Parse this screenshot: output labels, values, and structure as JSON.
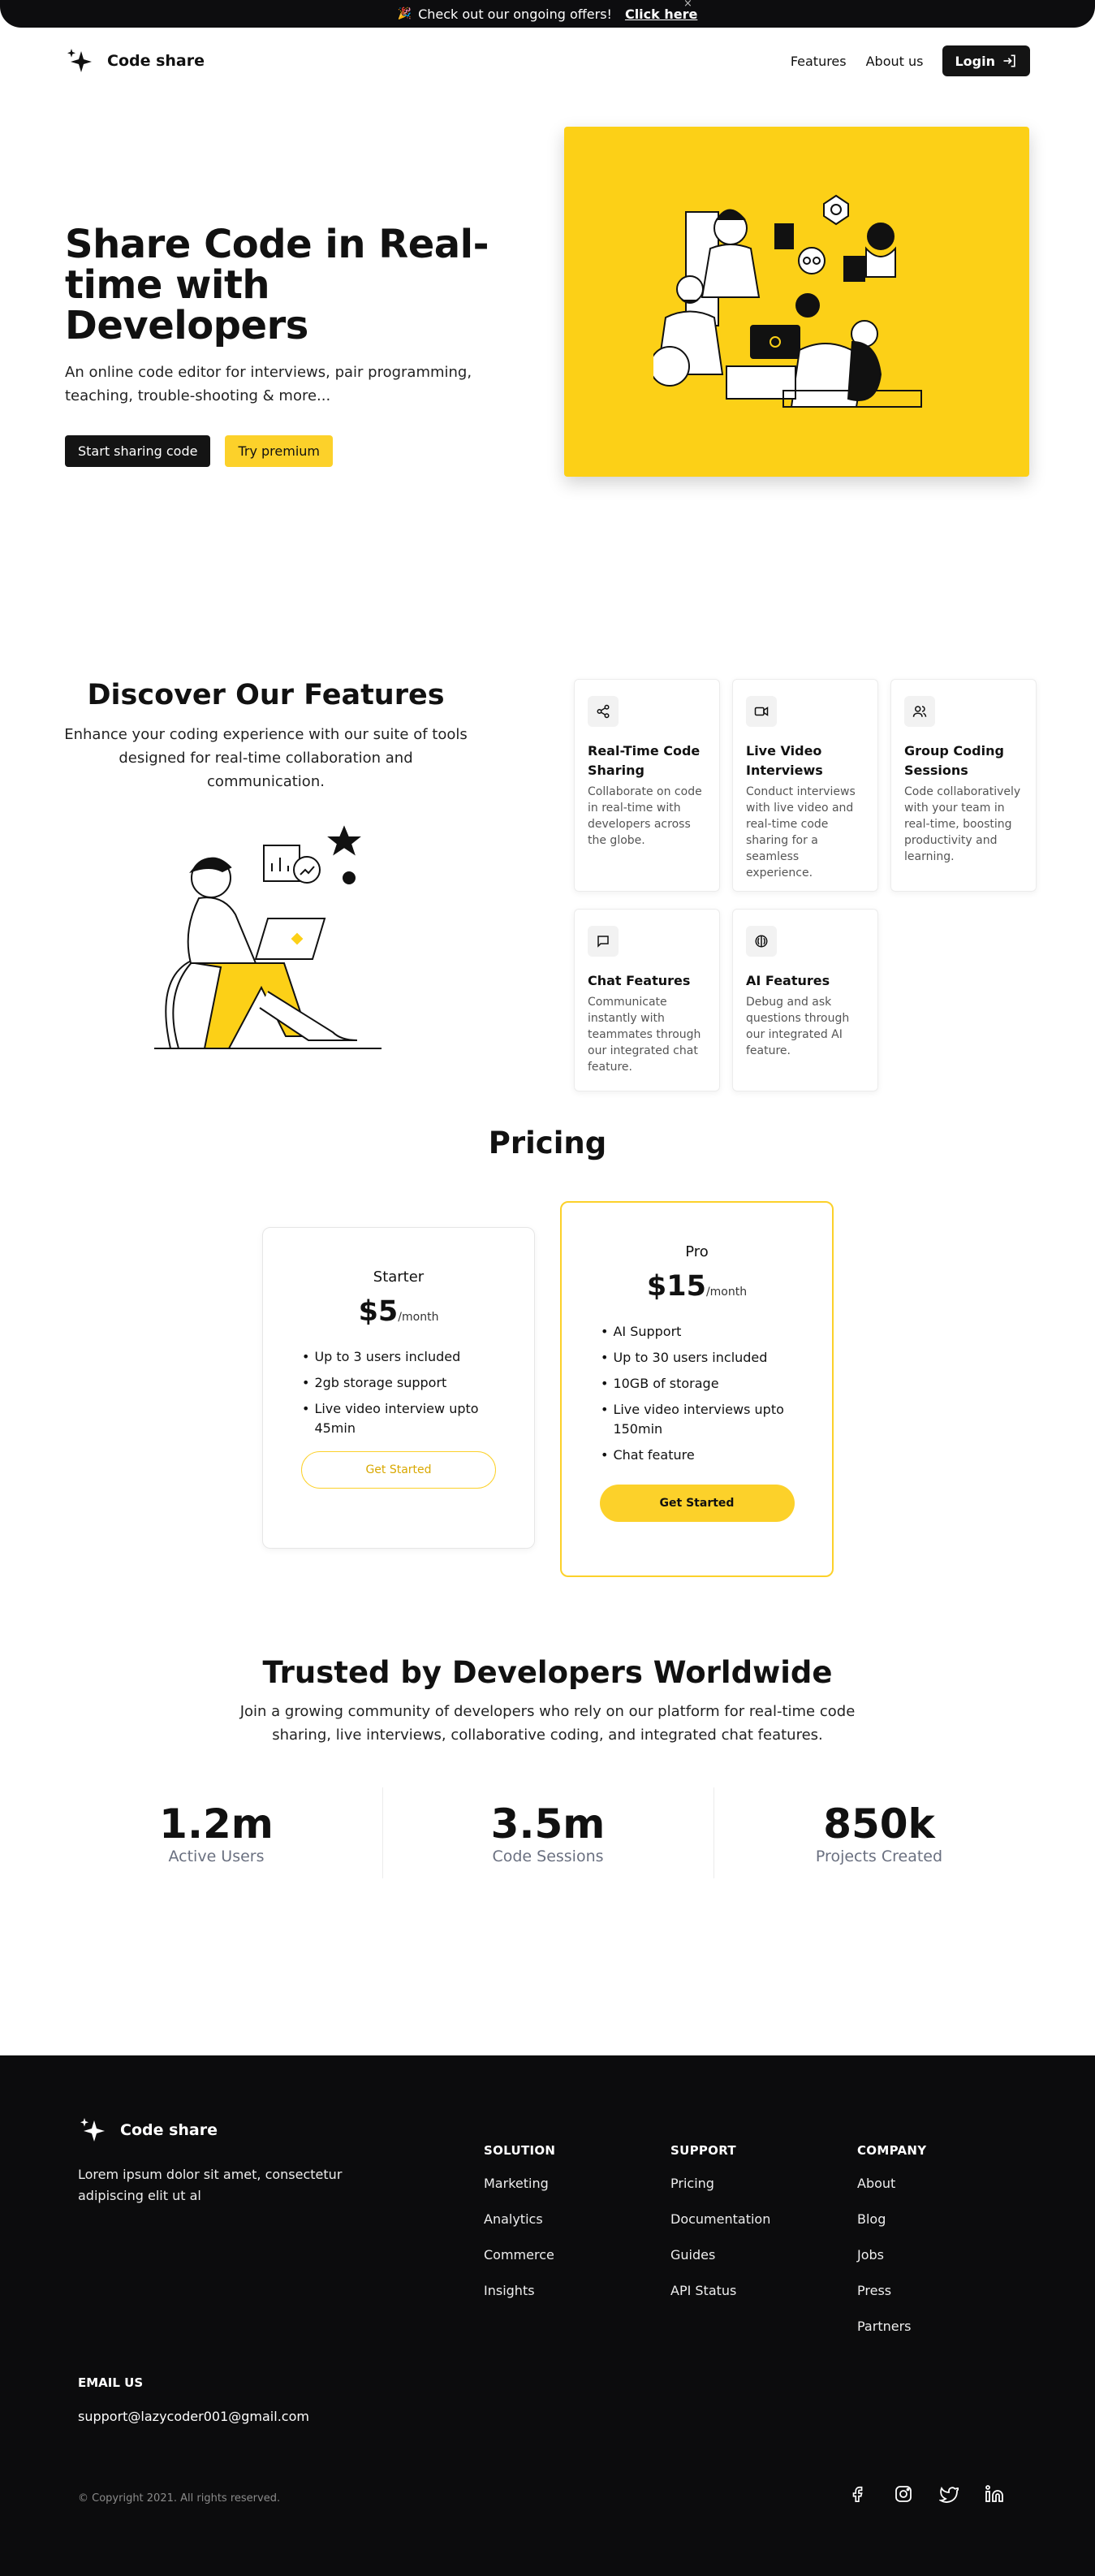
{
  "announcement": {
    "text": "Check out our ongoing offers!",
    "link": "Click here",
    "close": "×",
    "icon": "party-popper-icon"
  },
  "nav": {
    "brand": "Code share",
    "links": [
      "Features",
      "About us"
    ],
    "login": "Login"
  },
  "hero": {
    "title": "Share Code in Real-time with Developers",
    "subtitle": "An online code editor for interviews, pair programming, teaching, trouble-shooting & more...",
    "primary_button": "Start sharing code",
    "secondary_button": "Try premium",
    "accent_color": "#fcd017"
  },
  "features": {
    "title": "Discover Our Features",
    "subtitle": "Enhance your coding experience with our suite of tools designed for real-time collaboration and communication.",
    "cards": [
      {
        "icon": "share-icon",
        "title": "Real-Time Code Sharing",
        "desc": "Collaborate on code in real-time with developers across the globe."
      },
      {
        "icon": "video-icon",
        "title": "Live Video Interviews",
        "desc": "Conduct interviews with live video and real-time code sharing for a seamless experience."
      },
      {
        "icon": "users-icon",
        "title": "Group Coding Sessions",
        "desc": "Code collaboratively with your team in real-time, boosting productivity and learning."
      },
      {
        "icon": "chat-icon",
        "title": "Chat Features",
        "desc": "Communicate instantly with teammates through our integrated chat feature."
      },
      {
        "icon": "ai-brain-icon",
        "title": "AI Features",
        "desc": "Debug and ask questions through our integrated AI feature."
      }
    ]
  },
  "pricing": {
    "title": "Pricing",
    "plans": [
      {
        "name": "Starter",
        "price": "$5",
        "period": "/month",
        "features": [
          "Up to 3 users included",
          "2gb storage support",
          "Live video interview upto 45min"
        ],
        "cta": "Get Started"
      },
      {
        "name": "Pro",
        "price": "$15",
        "period": "/month",
        "features": [
          "AI Support",
          "Up to 30 users included",
          "10GB of storage",
          "Live video interviews upto 150min",
          "Chat feature"
        ],
        "cta": "Get Started"
      }
    ]
  },
  "trusted": {
    "title": "Trusted by Developers Worldwide",
    "subtitle": "Join a growing community of developers who rely on our platform for real-time code sharing, live interviews, collaborative coding, and integrated chat features.",
    "stats": [
      {
        "value": "1.2m",
        "label": "Active Users"
      },
      {
        "value": "3.5m",
        "label": "Code Sessions"
      },
      {
        "value": "850k",
        "label": "Projects Created"
      }
    ]
  },
  "footer": {
    "brand": "Code share",
    "description": "Lorem ipsum dolor sit amet, consectetur adipiscing elit ut al",
    "columns": [
      {
        "title": "SOLUTION",
        "links": [
          "Marketing",
          "Analytics",
          "Commerce",
          "Insights"
        ]
      },
      {
        "title": "SUPPORT",
        "links": [
          "Pricing",
          "Documentation",
          "Guides",
          "API Status"
        ]
      },
      {
        "title": "COMPANY",
        "links": [
          "About",
          "Blog",
          "Jobs",
          "Press",
          "Partners"
        ]
      }
    ],
    "email_heading": "EMAIL US",
    "email": "support@lazycoder001@gmail.com",
    "copyright": "© Copyright 2021. All rights reserved.",
    "social": [
      "facebook-icon",
      "instagram-icon",
      "twitter-icon",
      "linkedin-icon"
    ]
  }
}
